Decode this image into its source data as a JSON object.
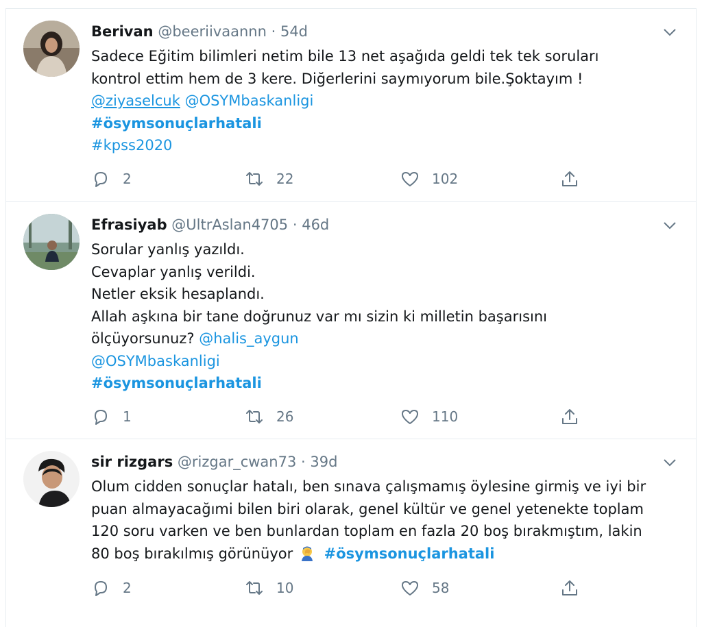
{
  "tweets": [
    {
      "name": "Berivan",
      "handle": "@beeriivaannn",
      "sep": "·",
      "time": "54d",
      "lines": [
        "Sadece Eğitim bilimleri netim bile 13 net aşağıda geldi tek tek soruları",
        "kontrol ettim hem de 3 kere. Diğerlerini saymıyorum bile.Şoktayım !"
      ],
      "mention1": "@ziyaselcuk",
      "mention2": "@OSYMbaskanligi",
      "hashtag1": "#ösymsonuçlarhatali",
      "hashtag2": "#kpss2020",
      "replies": "2",
      "retweets": "22",
      "likes": "102"
    },
    {
      "name": "Efrasiyab",
      "handle": "@UltrAslan4705",
      "sep": "·",
      "time": "46d",
      "lines": [
        "Sorular yanlış yazıldı.",
        "Cevaplar yanlış verildi.",
        "Netler eksik hesaplandı.",
        "Allah aşkına bir tane doğrunuz var mı sizin ki milletin başarısını",
        "ölçüyorsunuz?"
      ],
      "mention1": "@halis_aygun",
      "mention2": "@OSYMbaskanligi",
      "hashtag1": "#ösymsonuçlarhatali",
      "replies": "1",
      "retweets": "26",
      "likes": "110"
    },
    {
      "name": "sir rizgars",
      "handle": "@rizgar_cwan73",
      "sep": "·",
      "time": "39d",
      "lines": [
        "Olum cidden sonuçlar hatalı, ben sınava çalışmamış öylesine girmiş ve iyi bir",
        "puan almayacağımi bilen biri olarak, genel kültür ve genel yetenekte toplam",
        "120 soru varken ve ben bunlardan toplam en fazla 20 boş bırakmıştım, lakin",
        "80 boş bırakılmış görünüyor"
      ],
      "hashtag1": "#ösymsonuçlarhatali",
      "replies": "2",
      "retweets": "10",
      "likes": "58"
    }
  ],
  "icons": {
    "reply": "reply-icon",
    "retweet": "retweet-icon",
    "like": "heart-icon",
    "share": "share-icon",
    "more": "chevron-down-icon",
    "emoji": "facepalm-emoji"
  },
  "colors": {
    "link": "#1b95e0",
    "muted": "#657786",
    "border": "#e6ecf0"
  }
}
